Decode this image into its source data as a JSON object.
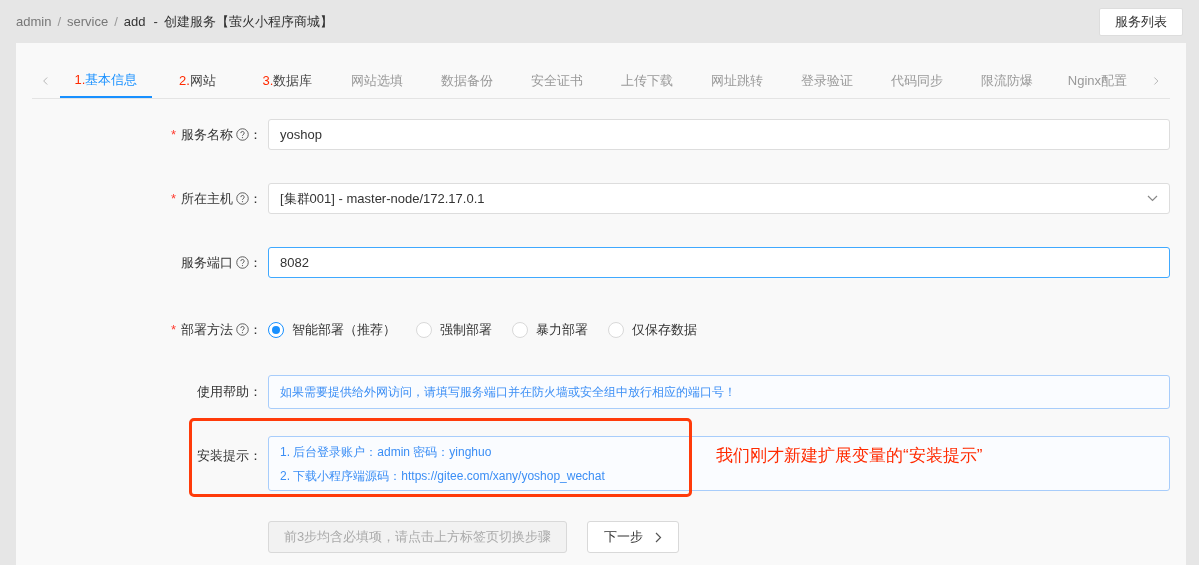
{
  "breadcrumb": [
    "admin",
    "service",
    "add"
  ],
  "breadcrumb_separator": "/",
  "title_separator": "-",
  "required_mark": "*",
  "label_suffix": "：",
  "page_title": "创建服务【萤火小程序商城】",
  "header_button": "服务列表",
  "tabs": [
    {
      "step": "1.",
      "label": "基本信息",
      "selected": true,
      "disabled": false
    },
    {
      "step": "2.",
      "label": "网站",
      "selected": false,
      "disabled": false
    },
    {
      "step": "3.",
      "label": "数据库",
      "selected": false,
      "disabled": false
    },
    {
      "label": "网站选填",
      "selected": false,
      "disabled": true
    },
    {
      "label": "数据备份",
      "selected": false,
      "disabled": true
    },
    {
      "label": "安全证书",
      "selected": false,
      "disabled": true
    },
    {
      "label": "上传下载",
      "selected": false,
      "disabled": true
    },
    {
      "label": "网址跳转",
      "selected": false,
      "disabled": true
    },
    {
      "label": "登录验证",
      "selected": false,
      "disabled": true
    },
    {
      "label": "代码同步",
      "selected": false,
      "disabled": true
    },
    {
      "label": "限流防爆",
      "selected": false,
      "disabled": true
    },
    {
      "label": "Nginx配置",
      "selected": false,
      "disabled": true
    }
  ],
  "form": [
    {
      "kind": "input",
      "label": "服务名称",
      "required": true,
      "help": true,
      "value": "yoshop",
      "focused": false
    },
    {
      "kind": "select",
      "label": "所在主机",
      "required": true,
      "help": true,
      "value": "[集群001] - master-node/172.17.0.1",
      "focused": false
    },
    {
      "kind": "input",
      "label": "服务端口",
      "required": false,
      "help": true,
      "value": "8082",
      "focused": true
    },
    {
      "kind": "radio",
      "label": "部署方法",
      "required": true,
      "help": true,
      "options": [
        {
          "label": "智能部署（推荐）",
          "selected": true
        },
        {
          "label": "强制部署",
          "selected": false
        },
        {
          "label": "暴力部署",
          "selected": false
        },
        {
          "label": "仅保存数据",
          "selected": false
        }
      ]
    },
    {
      "kind": "notice",
      "label": "使用帮助",
      "required": false,
      "help": false,
      "lines": [
        "如果需要提供给外网访问，请填写服务端口并在防火墙或安全组中放行相应的端口号！"
      ]
    },
    {
      "kind": "notice",
      "label": "安装提示",
      "required": false,
      "help": false,
      "lines": [
        "1. 后台登录账户：admin 密码：yinghuo",
        "2. 下载小程序端源码：https://gitee.com/xany/yoshop_wechat"
      ]
    }
  ],
  "actions": [
    {
      "label": "前3步均含必填项，请点击上方标签页切换步骤",
      "disabled": true
    },
    {
      "label": "下一步",
      "disabled": false
    }
  ],
  "annotation": "我们刚才新建扩展变量的“安装提示”"
}
